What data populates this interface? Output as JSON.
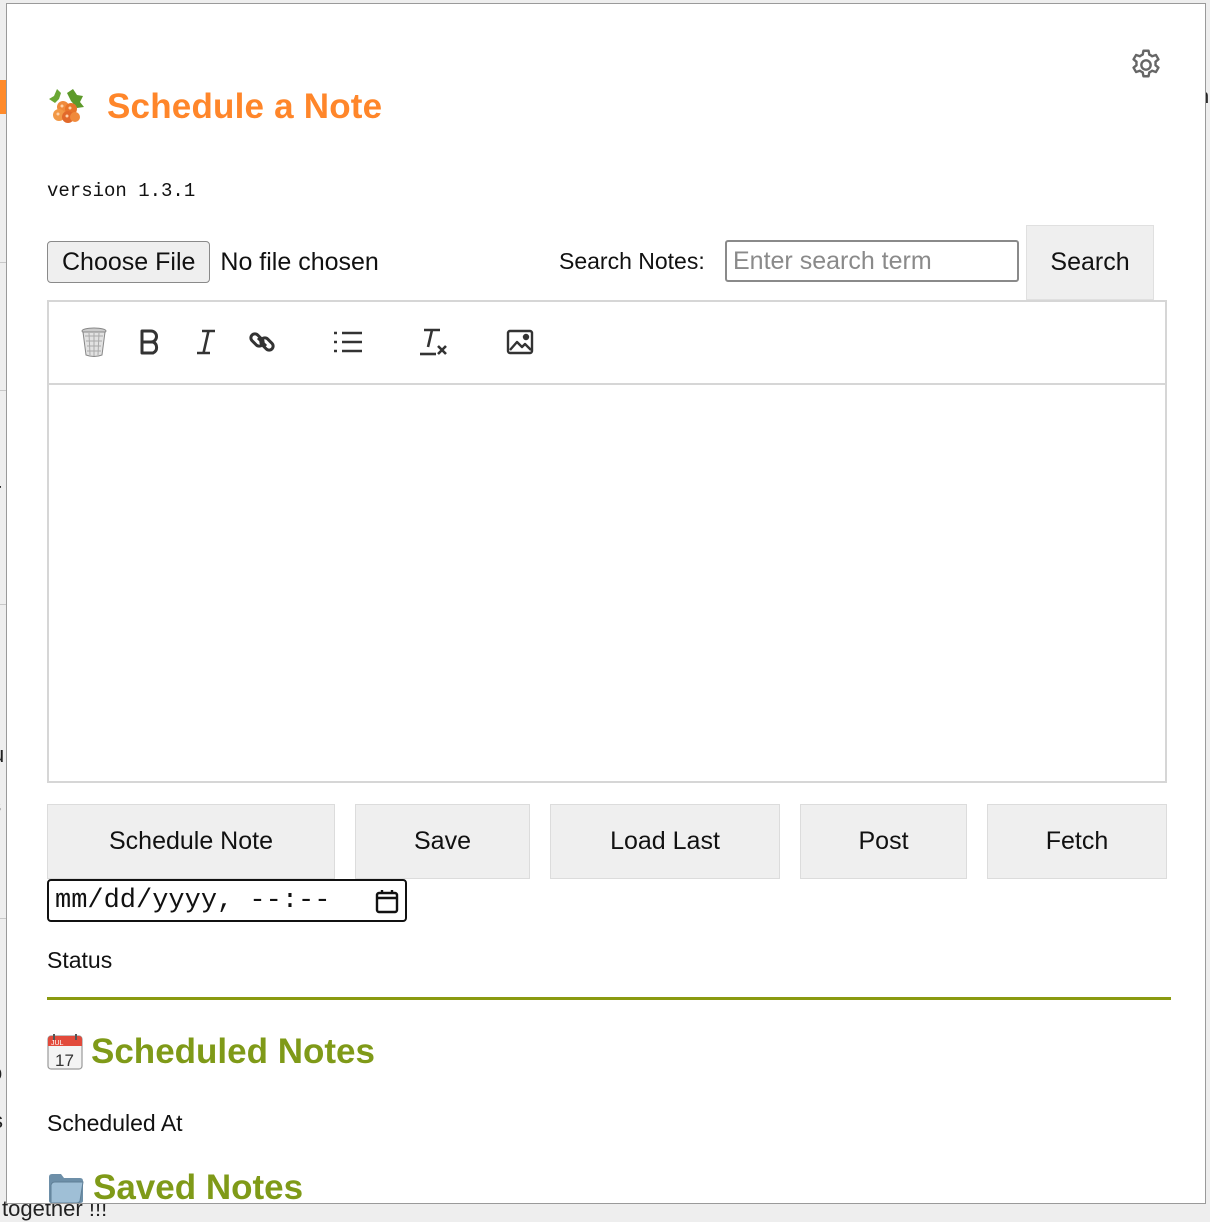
{
  "background": {
    "fragment_left_1": "r",
    "fragment_left_2": "u",
    "fragment_left_3": "s",
    "fragment_left_4": "o",
    "fragment_left_5": "s",
    "fragment_bottom": "together !!!",
    "fragment_right": "h"
  },
  "header": {
    "title": "Schedule a Note",
    "logo_icon": "cloudberry-icon",
    "settings_icon": "gear-icon"
  },
  "version": "version 1.3.1",
  "file": {
    "choose_label": "Choose File",
    "status": "No file chosen"
  },
  "search": {
    "label": "Search Notes:",
    "placeholder": "Enter search term",
    "value": "",
    "button_label": "Search"
  },
  "toolbar": {
    "tools": [
      "trash-icon",
      "bold-icon",
      "italic-icon",
      "link-icon",
      "bullet-list-icon",
      "clear-format-icon",
      "image-icon"
    ]
  },
  "actions": {
    "schedule_label": "Schedule Note",
    "save_label": "Save",
    "load_last_label": "Load Last",
    "post_label": "Post",
    "fetch_label": "Fetch"
  },
  "datetime": {
    "placeholder": "mm/dd/yyyy, --:--",
    "icon": "calendar-icon"
  },
  "status": "Status",
  "colors": {
    "accent_orange": "#ff862a",
    "section_green": "#7f9a18",
    "divider_green": "#8a9a10"
  },
  "scheduled_section": {
    "title": "Scheduled Notes",
    "icon": "calendar-icon",
    "calendar_month": "JUL",
    "calendar_day": "17",
    "column_label": "Scheduled At"
  },
  "saved_section": {
    "title": "Saved Notes",
    "icon": "folder-icon"
  }
}
